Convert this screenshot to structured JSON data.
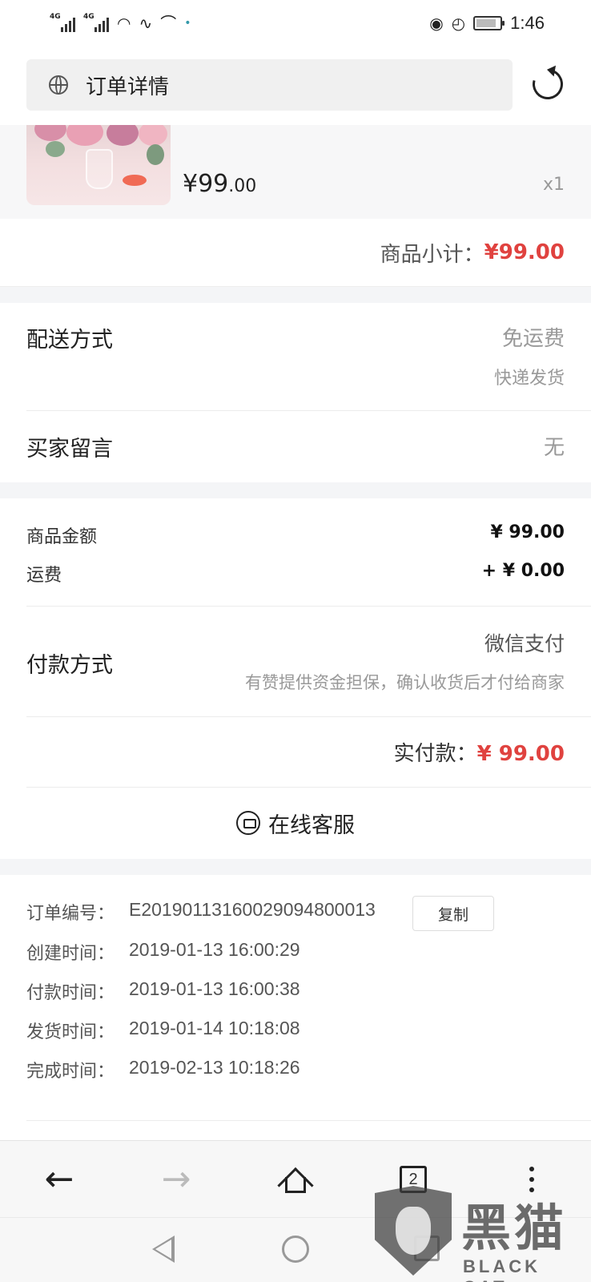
{
  "status_bar": {
    "signal1": "4G",
    "signal2": "4G",
    "time": "1:46"
  },
  "browser": {
    "page_title": "订单详情",
    "tab_count": "2"
  },
  "product": {
    "price_main": "¥99",
    "price_decimal": ".00",
    "quantity": "x1",
    "subtotal_label": "商品小计：",
    "subtotal_value": "¥99.00"
  },
  "delivery": {
    "label": "配送方式",
    "fee": "免运费",
    "method": "快递发货"
  },
  "buyer_message": {
    "label": "买家留言",
    "value": "无"
  },
  "amounts": {
    "goods_label": "商品金额",
    "goods_value": "¥ 99.00",
    "shipping_label": "运费",
    "shipping_value": "+ ¥ 0.00"
  },
  "payment": {
    "label": "付款方式",
    "method": "微信支付",
    "note": "有赞提供资金担保，确认收货后才付给商家",
    "paid_label": "实付款：",
    "paid_value": "¥ 99.00"
  },
  "service": {
    "label": "在线客服"
  },
  "order_info": {
    "rows": [
      {
        "key": "订单编号：",
        "value": "E20190113160029094800013"
      },
      {
        "key": "创建时间：",
        "value": "2019-01-13 16:00:29"
      },
      {
        "key": "付款时间：",
        "value": "2019-01-13 16:00:38"
      },
      {
        "key": "发货时间：",
        "value": "2019-01-14 10:18:08"
      },
      {
        "key": "完成时间：",
        "value": "2019-02-13 10:18:26"
      }
    ],
    "copy_label": "复制"
  },
  "watermark": {
    "cn": "黑猫",
    "en": "BLACK CAT"
  },
  "colors": {
    "accent_red": "#e0423f",
    "muted": "#999999"
  }
}
